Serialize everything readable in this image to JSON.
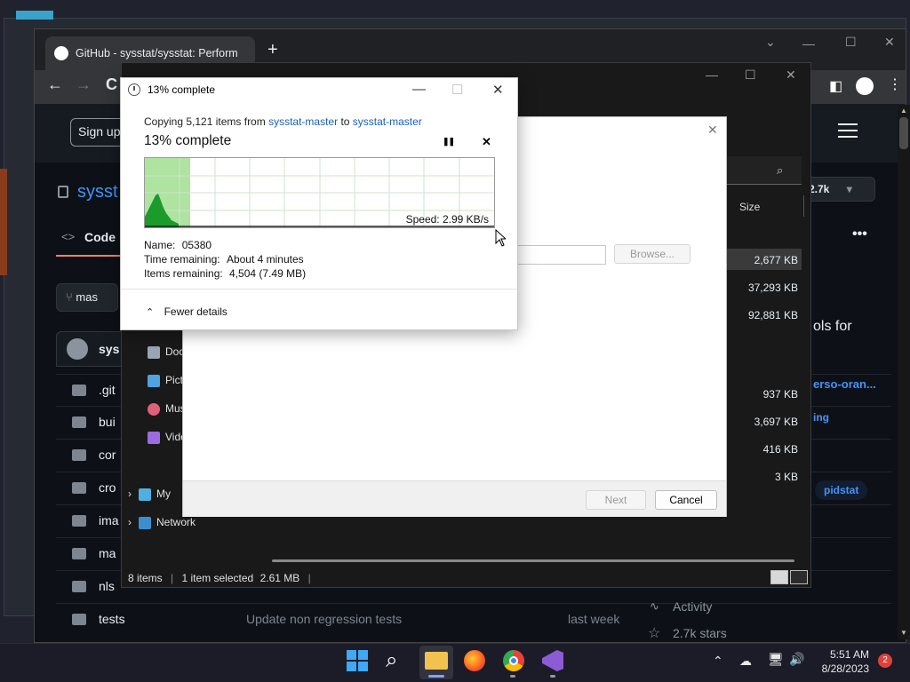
{
  "browser": {
    "tab_title": "GitHub - sysstat/sysstat: Perform",
    "new_tab": "+",
    "back": "←",
    "forward": "→",
    "reload": "C"
  },
  "github": {
    "signup": "Sign up",
    "repo_name": "sysst",
    "code_tab": "Code",
    "branch": "mas",
    "owner": "sys",
    "files": [
      {
        "name": ".git",
        "msg": "",
        "date": ""
      },
      {
        "name": "bui",
        "msg": "",
        "date": ""
      },
      {
        "name": "cor",
        "msg": "",
        "date": ""
      },
      {
        "name": "cro",
        "msg": "",
        "date": ""
      },
      {
        "name": "ima",
        "msg": "",
        "date": ""
      },
      {
        "name": "ma",
        "msg": "",
        "date": ""
      },
      {
        "name": "nls",
        "msg": "",
        "date": ""
      },
      {
        "name": "tests",
        "msg": "Update non regression tests",
        "date": "last week"
      }
    ],
    "sidebar": {
      "stars_count": "2.7k",
      "about_fragment": "ols for",
      "link_fragment": "erso-oran...",
      "tag1": "ing",
      "tag2": "pidstat",
      "activity": "Activity",
      "stars": "2.7k stars"
    }
  },
  "explorer": {
    "size_header": "Size",
    "sizes": [
      "2,677 KB",
      "37,293 KB",
      "92,881 KB",
      "937 KB",
      "3,697 KB",
      "416 KB",
      "3 KB"
    ],
    "nav": [
      {
        "label": "Doc",
        "color": "#9aa6b4"
      },
      {
        "label": "Pict",
        "color": "#4fa3e0"
      },
      {
        "label": "Mus",
        "color": "#e0607a"
      },
      {
        "label": "Vide",
        "color": "#9b6be0"
      },
      {
        "label": "My",
        "color": "#4fb0e0"
      },
      {
        "label": "Network",
        "color": "#3b8fd0"
      }
    ],
    "status": {
      "items": "8 items",
      "selected": "1 item selected",
      "size": "2.61 MB"
    }
  },
  "wizard": {
    "browse": "Browse...",
    "next": "Next",
    "cancel": "Cancel"
  },
  "copy_dialog": {
    "title": "13% complete",
    "copying_prefix": "Copying 5,121 items from",
    "source": "sysstat-master",
    "to": "to",
    "dest": "sysstat-master",
    "percent_label": "13% complete",
    "progress_fraction": 0.13,
    "speed": "Speed: 2.99 KB/s",
    "name_label": "Name:",
    "name_value": "05380",
    "time_label": "Time remaining:",
    "time_value": "About 4 minutes",
    "items_label": "Items remaining:",
    "items_value": "4,504 (7.49 MB)",
    "fewer": "Fewer details",
    "pause": "❚❚",
    "close": "✕"
  },
  "taskbar": {
    "time": "5:51 AM",
    "date": "8/28/2023",
    "notifications": "2"
  }
}
